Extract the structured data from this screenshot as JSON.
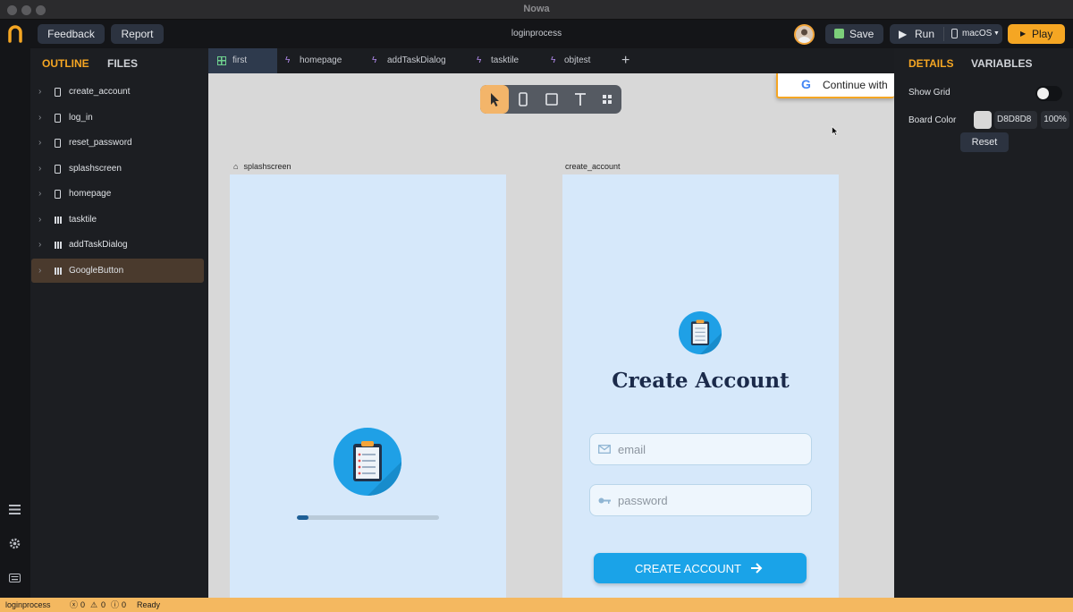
{
  "window": {
    "title": "Nowa"
  },
  "topbar": {
    "feedback_label": "Feedback",
    "report_label": "Report",
    "project_name": "loginprocess",
    "save_label": "Save",
    "run_label": "Run",
    "platform": "macOS",
    "play_label": "Play"
  },
  "left_panel": {
    "tabs": [
      "OUTLINE",
      "FILES"
    ],
    "items": [
      {
        "label": "create_account",
        "icon": "phone-icon"
      },
      {
        "label": "log_in",
        "icon": "phone-icon"
      },
      {
        "label": "reset_password",
        "icon": "phone-icon"
      },
      {
        "label": "splashscreen",
        "icon": "phone-icon"
      },
      {
        "label": "homepage",
        "icon": "phone-icon"
      },
      {
        "label": "tasktile",
        "icon": "grid-icon"
      },
      {
        "label": "addTaskDialog",
        "icon": "grid-icon"
      },
      {
        "label": "GoogleButton",
        "icon": "grid-icon",
        "selected": true
      }
    ]
  },
  "tabs": [
    {
      "label": "first",
      "icon": "grid-icon",
      "active": true
    },
    {
      "label": "homepage",
      "icon": "bolt-icon"
    },
    {
      "label": "addTaskDialog",
      "icon": "bolt-icon"
    },
    {
      "label": "tasktile",
      "icon": "bolt-icon"
    },
    {
      "label": "objtest",
      "icon": "bolt-icon"
    }
  ],
  "canvas": {
    "google_button_text": "Continue with",
    "splash_label": "splashscreen",
    "create_label": "create_account",
    "splash_progress": 0.08,
    "create_title": "Create Account",
    "email_placeholder": "email",
    "password_placeholder": "password",
    "create_button": "CREATE ACCOUNT"
  },
  "right_panel": {
    "tabs": [
      "DETAILS",
      "VARIABLES"
    ],
    "show_grid_label": "Show Grid",
    "board_color_label": "Board Color",
    "board_color_value": "D8D8D8",
    "board_opacity": "100%",
    "reset_label": "Reset"
  },
  "statusbar": {
    "project": "loginprocess",
    "errors": "0",
    "warnings": "0",
    "infos": "0",
    "status": "Ready"
  },
  "colors": {
    "accent": "#f5a623",
    "canvas_bg": "#d8d8d8",
    "frame_bg": "#d6e8fa",
    "primary_button": "#1aa3e8",
    "title_text": "#1b2a4a"
  }
}
